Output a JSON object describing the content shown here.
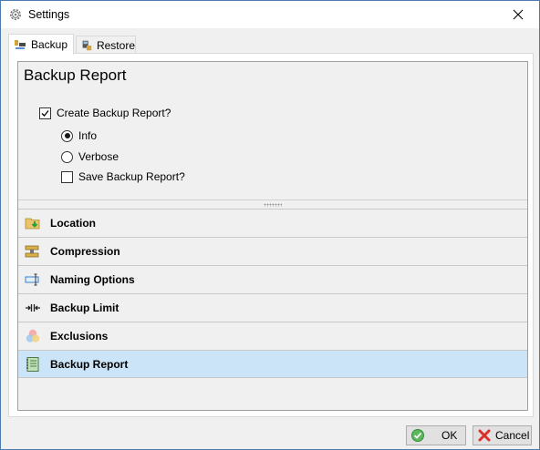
{
  "window": {
    "title": "Settings"
  },
  "tabs": [
    {
      "label": "Backup",
      "icon": "backup-icon",
      "active": true
    },
    {
      "label": "Restore",
      "icon": "restore-icon",
      "active": false
    }
  ],
  "report": {
    "title": "Backup Report",
    "create_label": "Create Backup Report?",
    "create_checked": true,
    "info_label": "Info",
    "verbose_label": "Verbose",
    "level_selected": "Info",
    "save_label": "Save Backup Report?",
    "save_checked": false
  },
  "nav": [
    {
      "label": "Location",
      "icon": "folder-download-icon"
    },
    {
      "label": "Compression",
      "icon": "compression-icon"
    },
    {
      "label": "Naming Options",
      "icon": "rename-icon"
    },
    {
      "label": "Backup Limit",
      "icon": "limit-arrows-icon"
    },
    {
      "label": "Exclusions",
      "icon": "exclusions-circles-icon"
    },
    {
      "label": "Backup Report",
      "icon": "report-notebook-icon",
      "selected": true
    }
  ],
  "buttons": {
    "ok": "OK",
    "cancel": "Cancel"
  },
  "colors": {
    "selected_row": "#cce4f7",
    "window_border": "#4a7cb0"
  }
}
